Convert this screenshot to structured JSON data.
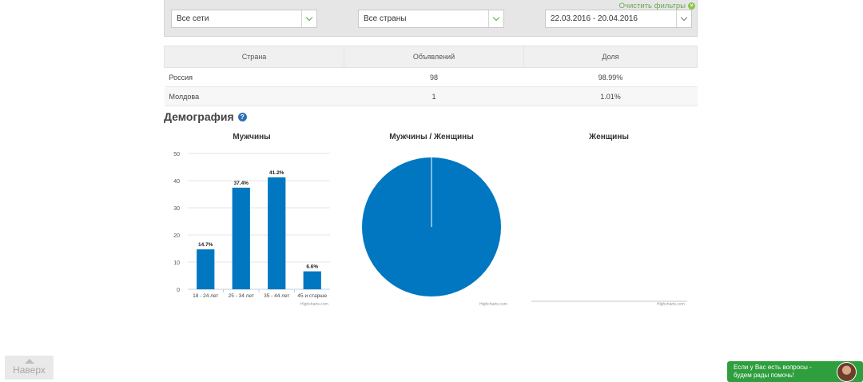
{
  "filters": {
    "clear_label": "Очистить фильтры",
    "network": "Все сети",
    "country": "Все страны",
    "date_range": "22.03.2016 - 20.04.2016"
  },
  "table": {
    "headers": [
      "Страна",
      "Объявлений",
      "Доля"
    ],
    "rows": [
      {
        "country": "Россия",
        "ads": "98",
        "share": "98.99%"
      },
      {
        "country": "Молдова",
        "ads": "1",
        "share": "1.01%"
      }
    ]
  },
  "section_title": "Демография",
  "back_to_top": "Наверх",
  "chat_text": [
    "Если у Вас есть вопросы -",
    "будем рады помочь!"
  ],
  "credit": "Highcharts.com",
  "colors": {
    "accent": "#0077c0",
    "green": "#2e9e3e"
  },
  "chart_data": [
    {
      "type": "bar",
      "title": "Мужчины",
      "categories": [
        "18 - 24 лет",
        "25 - 34 лет",
        "35 - 44 лет",
        "45 и старше"
      ],
      "values": [
        14.7,
        37.4,
        41.2,
        6.6
      ],
      "data_labels": [
        "14.7%",
        "37.4%",
        "41.2%",
        "6.6%"
      ],
      "yticks": [
        0,
        10,
        20,
        30,
        40,
        50
      ],
      "ylim": [
        0,
        50
      ],
      "grid": true
    },
    {
      "type": "pie",
      "title": "Мужчины / Женщины",
      "slices": [
        {
          "label": "Мужчины",
          "value": 100
        }
      ]
    },
    {
      "type": "bar",
      "title": "Женщины",
      "categories": [],
      "values": []
    }
  ]
}
